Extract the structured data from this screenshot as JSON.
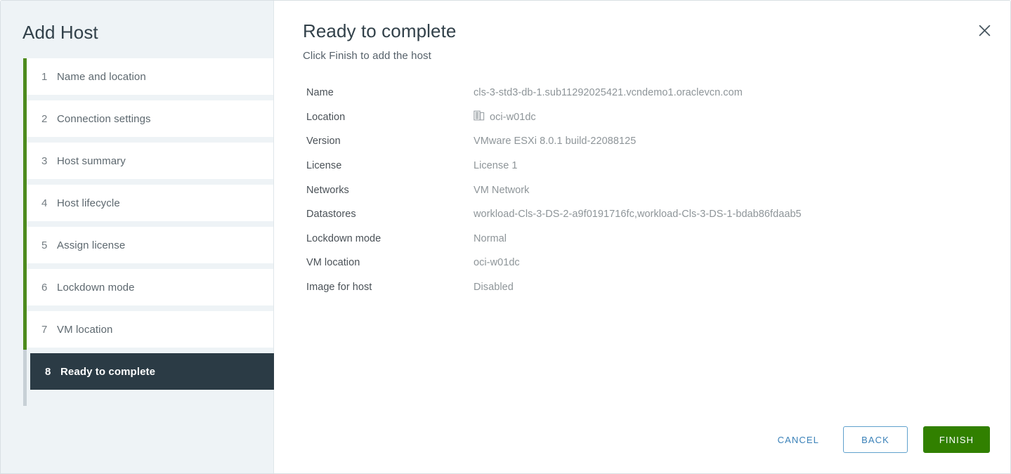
{
  "wizard": {
    "title": "Add Host",
    "steps": [
      {
        "num": "1",
        "label": "Name and location"
      },
      {
        "num": "2",
        "label": "Connection settings"
      },
      {
        "num": "3",
        "label": "Host summary"
      },
      {
        "num": "4",
        "label": "Host lifecycle"
      },
      {
        "num": "5",
        "label": "Assign license"
      },
      {
        "num": "6",
        "label": "Lockdown mode"
      },
      {
        "num": "7",
        "label": "VM location"
      },
      {
        "num": "8",
        "label": "Ready to complete"
      }
    ]
  },
  "panel": {
    "title": "Ready to complete",
    "subtitle": "Click Finish to add the host",
    "close_icon": "close-icon",
    "rows": [
      {
        "key": "Name",
        "value": "cls-3-std3-db-1.sub11292025421.vcndemo1.oraclevcn.com",
        "icon": ""
      },
      {
        "key": "Location",
        "value": "oci-w01dc",
        "icon": "datacenter-icon"
      },
      {
        "key": "Version",
        "value": "VMware ESXi 8.0.1 build-22088125",
        "icon": ""
      },
      {
        "key": "License",
        "value": "License 1",
        "icon": ""
      },
      {
        "key": "Networks",
        "value": "VM Network",
        "icon": ""
      },
      {
        "key": "Datastores",
        "value": "workload-Cls-3-DS-2-a9f0191716fc,workload-Cls-3-DS-1-bdab86fdaab5",
        "icon": ""
      },
      {
        "key": "Lockdown mode",
        "value": "Normal",
        "icon": ""
      },
      {
        "key": "VM location",
        "value": "oci-w01dc",
        "icon": ""
      },
      {
        "key": "Image for host",
        "value": "Disabled",
        "icon": ""
      }
    ]
  },
  "footer": {
    "cancel_label": "CANCEL",
    "back_label": "BACK",
    "finish_label": "FINISH"
  },
  "colors": {
    "progress_green": "#4d8b1d",
    "progress_gray": "#c7d0d6",
    "active_step_bg": "#2b3b45",
    "sidebar_bg": "#eef3f6",
    "link_blue": "#3a81b8",
    "primary_green": "#318000"
  }
}
